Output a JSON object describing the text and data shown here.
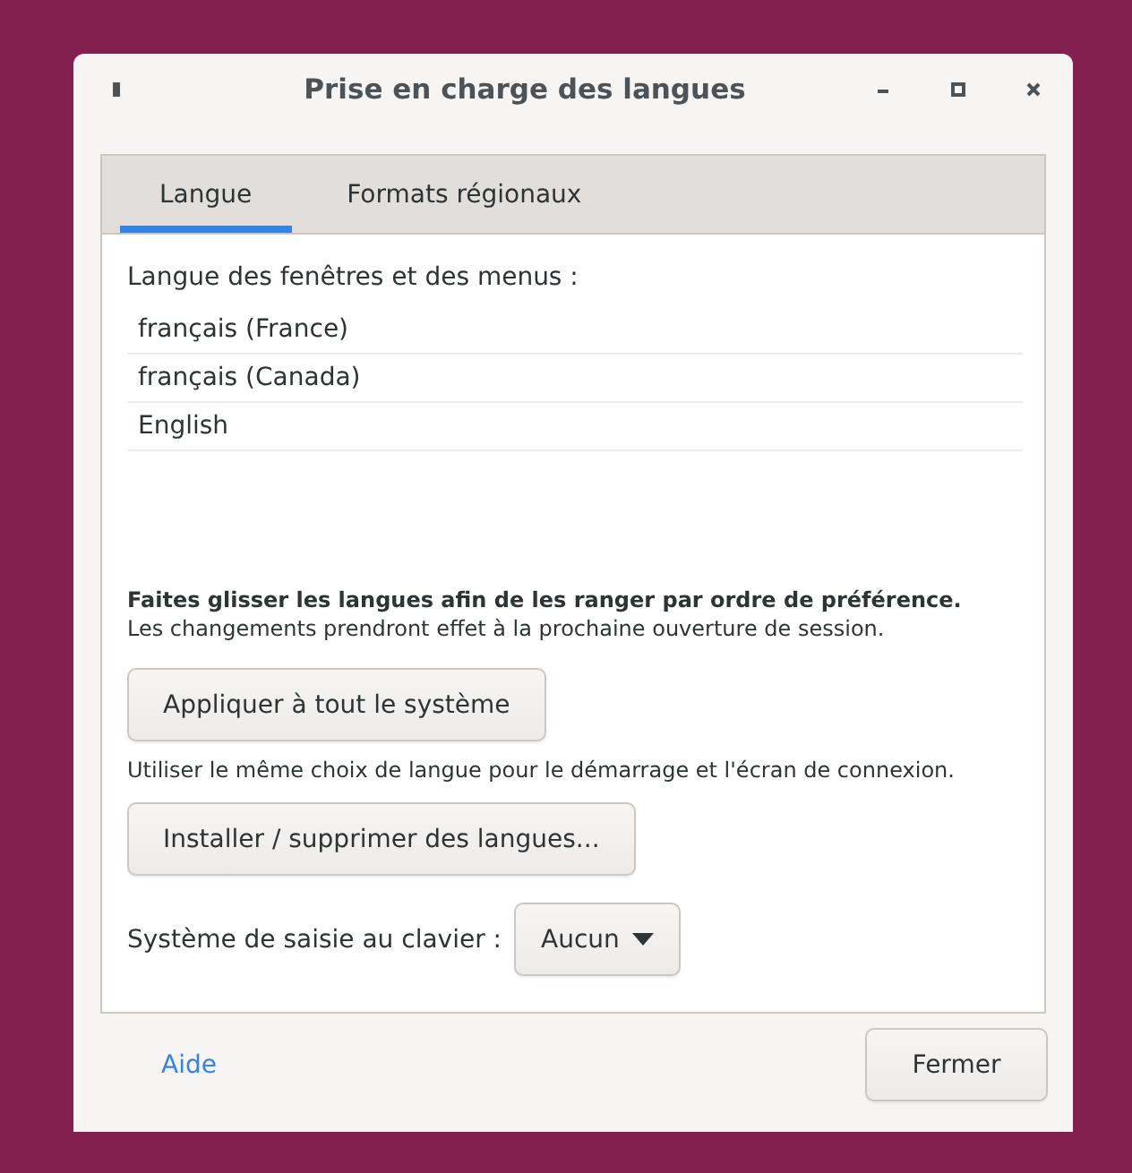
{
  "window": {
    "title": "Prise en charge des langues"
  },
  "tabs": [
    {
      "label": "Langue",
      "selected": true
    },
    {
      "label": "Formats régionaux",
      "selected": false
    }
  ],
  "language_list": {
    "label": "Langue des fenêtres et des menus :",
    "items": [
      {
        "label": "français (France)"
      },
      {
        "label": "français (Canada)"
      },
      {
        "label": "English"
      }
    ]
  },
  "hint": {
    "title": "Faites glisser les langues afin de les ranger par ordre de préférence.",
    "note": "Les changements prendront effet à la prochaine ouverture de session."
  },
  "apply_button": "Appliquer à tout le système",
  "apply_note": "Utiliser le même choix de langue pour le démarrage et l'écran de connexion.",
  "install_button": "Installer / supprimer des langues...",
  "input_method": {
    "label": "Système de saisie au clavier :",
    "value": "Aucun"
  },
  "footer": {
    "help": "Aide",
    "close": "Fermer"
  }
}
